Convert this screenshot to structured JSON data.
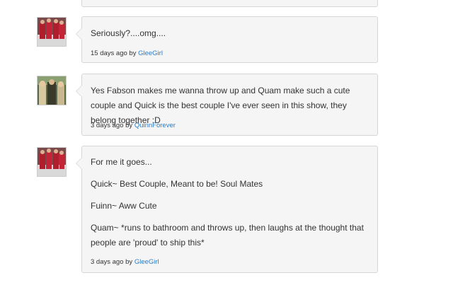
{
  "comments": [
    {
      "paragraphs": [
        "Seriously?....omg...."
      ],
      "time": "15 days ago",
      "by": "by",
      "author": "GleeGirl"
    },
    {
      "paragraphs": [
        "Yes Fabson makes me wanna throw up and Quam make such a cute couple and Quick is the best couple I've ever seen in this show, they belong together :D"
      ],
      "time": "3 days ago",
      "by": "by",
      "author": "QuinnForever"
    },
    {
      "paragraphs": [
        "For me it goes...",
        "Quick~ Best Couple, Meant to be! Soul Mates",
        "Fuinn~ Aww Cute",
        "Quam~ *runs to bathroom and throws up, then laughs at the thought that people are 'proud' to ship this*"
      ],
      "time": "3 days ago",
      "by": "by",
      "author": "GleeGirl"
    }
  ]
}
